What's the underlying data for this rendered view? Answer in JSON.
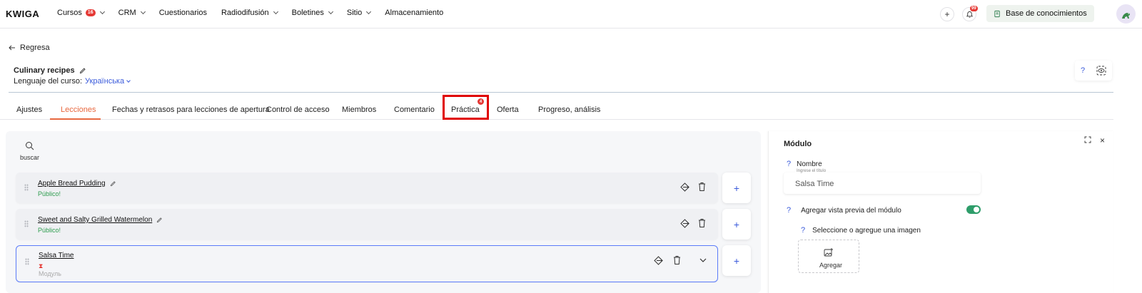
{
  "app": {
    "logo": "KWIGA"
  },
  "nav": {
    "items": [
      {
        "label": "Cursos",
        "badge": "16",
        "dropdown": true
      },
      {
        "label": "CRM",
        "dropdown": true
      },
      {
        "label": "Cuestionarios",
        "dropdown": false
      },
      {
        "label": "Radiodifusión",
        "dropdown": true
      },
      {
        "label": "Boletines",
        "dropdown": true
      },
      {
        "label": "Sitio",
        "dropdown": true
      },
      {
        "label": "Almacenamiento",
        "dropdown": false
      }
    ],
    "notifications_badge": "99",
    "knowledge_base_label": "Base de conocimientos"
  },
  "header": {
    "back_label": "Regresa",
    "course_title": "Culinary recipes",
    "language_label": "Lenguaje del curso:",
    "language_value": "Українська"
  },
  "tabs": [
    {
      "label": "Ajustes",
      "active": false
    },
    {
      "label": "Lecciones",
      "active": true
    },
    {
      "label": "Fechas y retrasos para lecciones de apertura",
      "active": false
    },
    {
      "label": "Control de acceso",
      "active": false
    },
    {
      "label": "Miembros",
      "active": false
    },
    {
      "label": "Comentario",
      "active": false
    },
    {
      "label": "Práctica",
      "active": false,
      "badge": "4",
      "highlighted": true
    },
    {
      "label": "Oferta",
      "active": false
    },
    {
      "label": "Progreso, análisis",
      "active": false
    }
  ],
  "lessons": {
    "search_label": "buscar",
    "rows": [
      {
        "title": "Apple Bread Pudding",
        "status": "Público!"
      },
      {
        "title": "Sweet and Salty Grilled Watermelon",
        "status": "Público!"
      },
      {
        "title": "Salsa Time",
        "status_icon": "hourglass-icon",
        "subtitle": "Модуль",
        "selected": true
      }
    ],
    "add_label": "+"
  },
  "module_panel": {
    "title": "Módulo",
    "help": "?",
    "name_label": "Nombre",
    "name_hint": "Ingrese el título",
    "name_value": "Salsa Time",
    "preview_label": "Agregar vista previa del módulo",
    "preview_enabled": true,
    "image_label": "Seleccione o agregue una imagen",
    "add_image_label": "Agregar"
  },
  "colors": {
    "accent": "#e8683f",
    "link": "#3b5bdb",
    "success": "#2e9d4f",
    "badge": "#e53935",
    "highlight": "#e00000"
  }
}
